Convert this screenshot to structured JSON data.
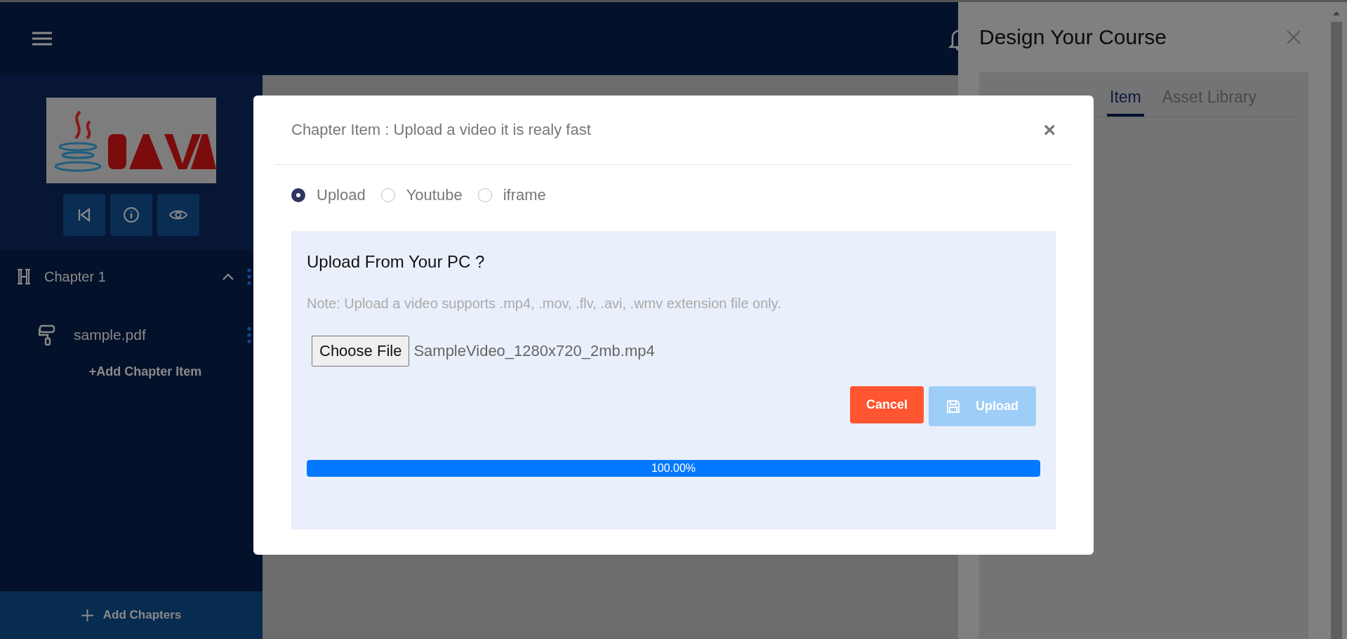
{
  "sidebar": {
    "chapters": [
      {
        "title": "Chapter 1",
        "expanded": true,
        "items": [
          {
            "title": "sample.pdf"
          }
        ],
        "add_item": "+Add Chapter Item"
      }
    ],
    "add_chapters": "Add Chapters"
  },
  "drawer": {
    "title": "Design Your Course",
    "tabs": [
      {
        "label": "Item",
        "selected": true
      },
      {
        "label": "Asset Library",
        "selected": false
      }
    ]
  },
  "modal": {
    "title": "Chapter Item : Upload a video it is realy fast",
    "close": "×",
    "sources": [
      {
        "label": "Upload",
        "selected": true
      },
      {
        "label": "Youtube",
        "selected": false
      },
      {
        "label": "iframe",
        "selected": false
      }
    ],
    "panel": {
      "heading": "Upload From Your PC ?",
      "note": "Note: Upload a video supports .mp4, .mov, .flv, .avi, .wmv extension file only.",
      "file_button": "Choose File",
      "file_name": "SampleVideo_1280x720_2mb.mp4",
      "cancel": "Cancel",
      "upload": {
        "label": "Upload",
        "disabled": true
      },
      "progress": {
        "level": 1,
        "reading": "100.00%"
      }
    }
  }
}
